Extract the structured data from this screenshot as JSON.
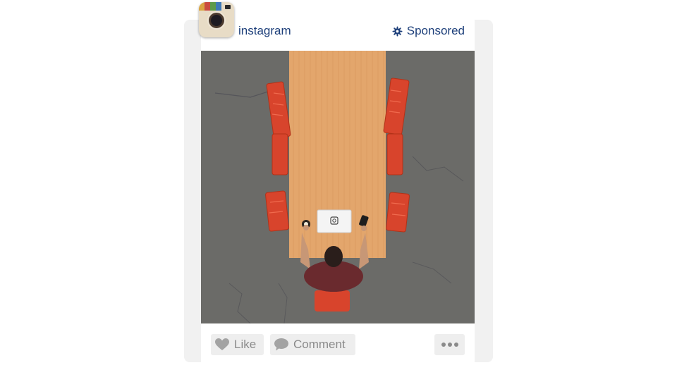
{
  "post": {
    "username": "instagram",
    "sponsored_label": "Sponsored",
    "photo_alt": "Overhead view of a man working at a long wooden table with red chairs on a concrete floor",
    "icons": {
      "avatar": "instagram-logo-icon",
      "sponsored": "sponsored-badge-icon",
      "like": "heart-icon",
      "comment": "speech-bubble-icon",
      "more": "more-dots-icon"
    }
  },
  "actions": {
    "like_label": "Like",
    "comment_label": "Comment"
  },
  "colors": {
    "username": "#1d3f7a",
    "button_bg": "#eeeeee",
    "button_text": "#8a8a8a",
    "chair_red": "#d8442c",
    "table_wood": "#e2a468",
    "floor": "#6e6e6c"
  }
}
